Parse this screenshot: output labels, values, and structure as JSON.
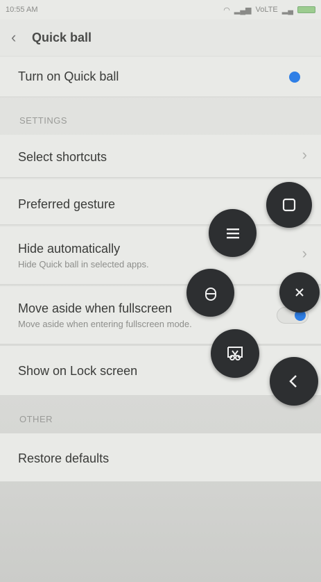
{
  "status_bar": {
    "time": "10:55 AM",
    "network": "VoLTE"
  },
  "header": {
    "title": "Quick ball"
  },
  "rows": {
    "turn_on": "Turn on Quick ball",
    "settings_label": "SETTINGS",
    "select_shortcuts": "Select shortcuts",
    "preferred_gesture": "Preferred gesture",
    "hide_auto_title": "Hide automatically",
    "hide_auto_sub": "Hide Quick ball in selected apps.",
    "move_aside_title": "Move aside when fullscreen",
    "move_aside_sub": "Move aside when entering fullscreen mode.",
    "lock_screen": "Show on Lock screen",
    "other_label": "OTHER",
    "restore": "Restore defaults"
  },
  "quick_ball": {
    "buttons": [
      "menu-icon",
      "recent-apps-icon",
      "lock-icon",
      "close-icon",
      "screenshot-icon",
      "back-icon"
    ]
  },
  "colors": {
    "accent": "#2f7fe6",
    "ball": "#2d2f31"
  }
}
